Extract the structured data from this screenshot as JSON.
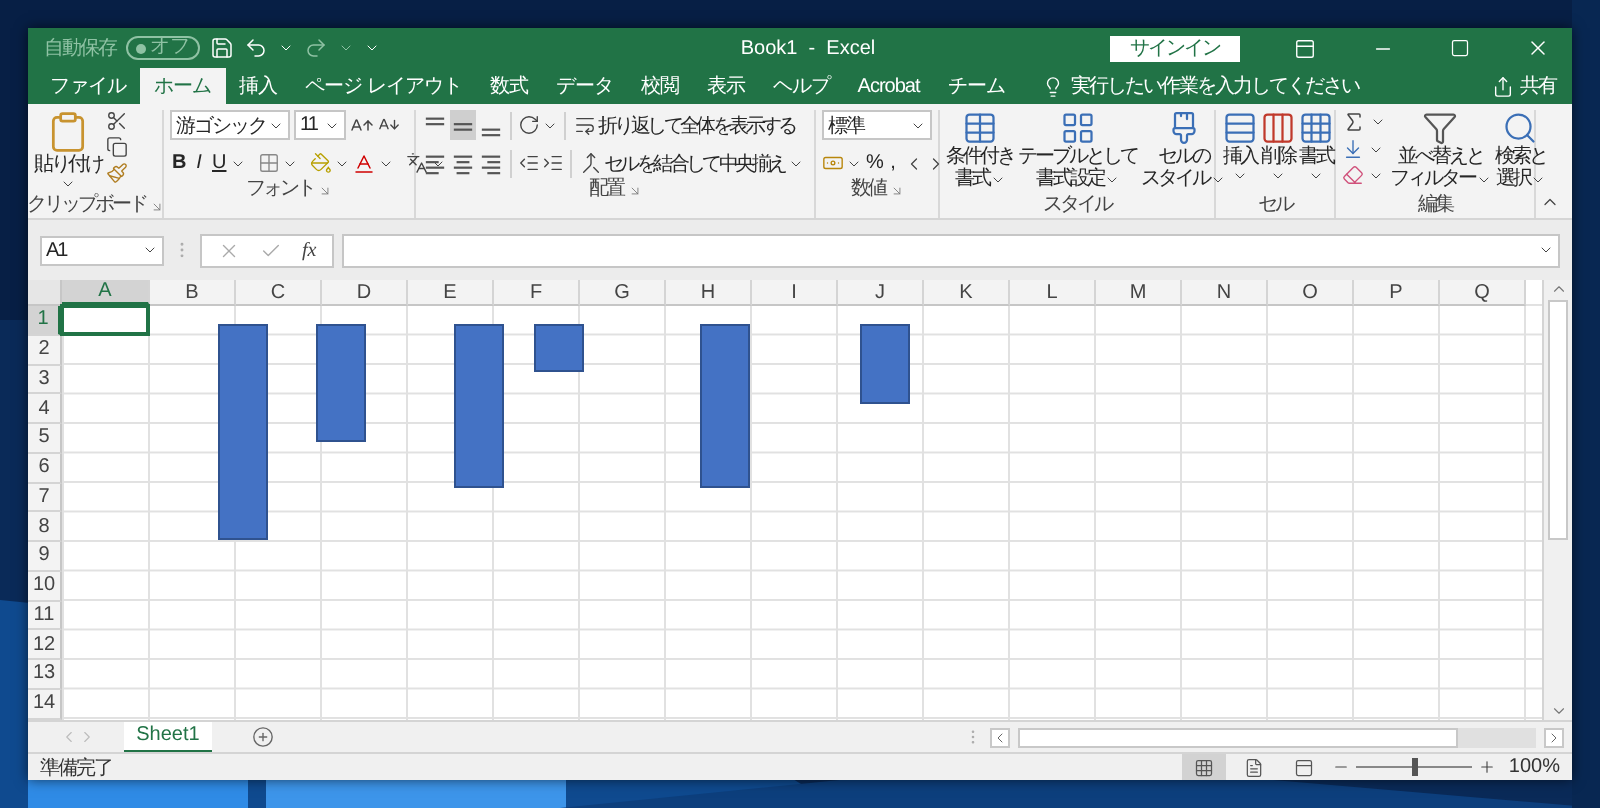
{
  "title_bar": {
    "autosave_label": "自動保存",
    "autosave_toggle": "オフ",
    "autosave_on": false,
    "title": "Book1  -  Excel",
    "sign_in": "サインイン"
  },
  "tabs": [
    {
      "label": "ファイル",
      "selected": false
    },
    {
      "label": "ホーム",
      "selected": true
    },
    {
      "label": "挿入",
      "selected": false
    },
    {
      "label": "ページ レイアウト",
      "selected": false
    },
    {
      "label": "数式",
      "selected": false
    },
    {
      "label": "データ",
      "selected": false
    },
    {
      "label": "校閲",
      "selected": false
    },
    {
      "label": "表示",
      "selected": false
    },
    {
      "label": "ヘルプ",
      "selected": false
    },
    {
      "label": "Acrobat",
      "selected": false
    },
    {
      "label": "チーム",
      "selected": false
    }
  ],
  "tell_me": "実行したい作業を入力してください",
  "share": "共有",
  "ribbon": {
    "clipboard": {
      "label": "クリップボード",
      "paste": "貼り付け"
    },
    "font": {
      "label": "フォント",
      "font_name": "游ゴシック",
      "font_size": "11",
      "bold": "B",
      "italic": "I",
      "underline": "U"
    },
    "alignment": {
      "label": "配置",
      "vertical": [
        {
          "selected": false
        },
        {
          "selected": true
        },
        {
          "selected": false
        }
      ],
      "horizontal": [
        {
          "selected": false
        },
        {
          "selected": false
        },
        {
          "selected": false
        }
      ],
      "wrap_text": "折り返して全体を表示する",
      "merge_center": "セルを結合して中央揃え"
    },
    "number": {
      "label": "数値",
      "format": "標準",
      "percent": "%",
      "comma": ","
    },
    "styles": {
      "label": "スタイル",
      "buttons": [
        {
          "lines": [
            "条件付き",
            "書式"
          ]
        },
        {
          "lines": [
            "テーブルとして",
            "書式設定"
          ]
        },
        {
          "lines": [
            "セルの",
            "スタイル"
          ]
        }
      ]
    },
    "cells": {
      "label": "セル",
      "buttons": [
        {
          "label": "挿入",
          "kind": "insert"
        },
        {
          "label": "削除",
          "kind": "delete"
        },
        {
          "label": "書式",
          "kind": "format"
        }
      ]
    },
    "editing": {
      "label": "編集",
      "sort_filter": [
        "並べ替えと",
        "フィルター"
      ],
      "find_select": [
        "検索と",
        "選択"
      ]
    }
  },
  "formula_bar": {
    "name_box": "A1",
    "fx": "fx"
  },
  "grid": {
    "columns": [
      {
        "label": "A",
        "selected": true
      },
      {
        "label": "B",
        "selected": false
      },
      {
        "label": "C",
        "selected": false
      },
      {
        "label": "D",
        "selected": false
      },
      {
        "label": "E",
        "selected": false
      },
      {
        "label": "F",
        "selected": false
      },
      {
        "label": "G",
        "selected": false
      },
      {
        "label": "H",
        "selected": false
      },
      {
        "label": "I",
        "selected": false
      },
      {
        "label": "J",
        "selected": false
      },
      {
        "label": "K",
        "selected": false
      },
      {
        "label": "L",
        "selected": false
      },
      {
        "label": "M",
        "selected": false
      },
      {
        "label": "N",
        "selected": false
      },
      {
        "label": "O",
        "selected": false
      },
      {
        "label": "P",
        "selected": false
      },
      {
        "label": "Q",
        "selected": false
      }
    ],
    "rows": [
      {
        "label": "1",
        "selected": true
      },
      {
        "label": "2",
        "selected": false
      },
      {
        "label": "3",
        "selected": false
      },
      {
        "label": "4",
        "selected": false
      },
      {
        "label": "5",
        "selected": false
      },
      {
        "label": "6",
        "selected": false
      },
      {
        "label": "7",
        "selected": false
      },
      {
        "label": "8",
        "selected": false
      },
      {
        "label": "9",
        "selected": false
      },
      {
        "label": "10",
        "selected": false
      },
      {
        "label": "11",
        "selected": false
      },
      {
        "label": "12",
        "selected": false
      },
      {
        "label": "13",
        "selected": false
      },
      {
        "label": "14",
        "selected": false
      }
    ]
  },
  "shapes": [
    {
      "kind": "rectangle"
    },
    {
      "kind": "rectangle"
    },
    {
      "kind": "rectangle"
    },
    {
      "kind": "rectangle"
    },
    {
      "kind": "rectangle"
    },
    {
      "kind": "rectangle"
    }
  ],
  "sheet_tabs": [
    {
      "label": "Sheet1",
      "selected": true
    }
  ],
  "status_bar": {
    "status": "準備完了",
    "views": [
      {
        "kind": "normal",
        "selected": true
      },
      {
        "kind": "page_layout",
        "selected": false
      },
      {
        "kind": "page_break",
        "selected": false
      }
    ],
    "zoom_slider": {
      "level": 0.5
    },
    "zoom": "100%"
  }
}
